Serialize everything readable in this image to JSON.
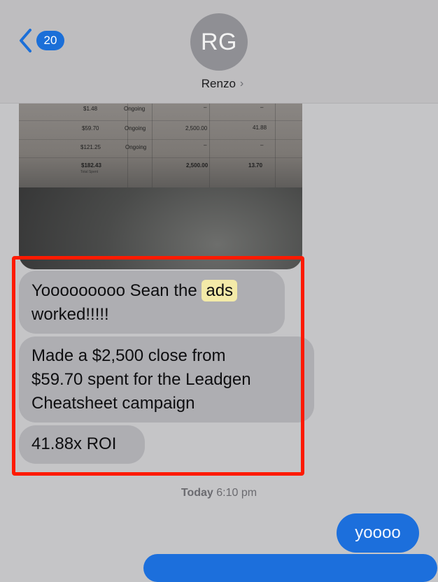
{
  "header": {
    "back_count": "20",
    "avatar_initials": "RG",
    "contact_name": "Renzo",
    "chevron": "›"
  },
  "photo": {
    "rows": [
      {
        "spent": "$1.48",
        "status": "Ongoing",
        "revenue": "–",
        "roi": "–"
      },
      {
        "spent": "$59.70",
        "status": "Ongoing",
        "revenue": "2,500.00",
        "roi": "41.88"
      },
      {
        "spent": "$121.25",
        "status": "Ongoing",
        "revenue": "–",
        "roi": "–"
      }
    ],
    "total": {
      "spent": "$182.43",
      "label": "Total Spent",
      "revenue": "2,500.00",
      "roi": "13.70"
    }
  },
  "messages": {
    "m1_before": "Yooooooooo Sean the ",
    "m1_highlight": "ads",
    "m1_after": "worked!!!!!",
    "m2_line1": "Made a $2,500 close from",
    "m2_line2": "$59.70 spent for the Leadgen",
    "m2_line3": "Cheatsheet campaign",
    "m3": "41.88x ROI"
  },
  "timestamp": {
    "day": "Today",
    "time": "6:10 pm"
  },
  "sent": {
    "m1": "yoooo"
  },
  "colors": {
    "incoming_bubble": "#aeaeb2",
    "outgoing_bubble": "#1c6fdc",
    "annotation": "#ff1a00",
    "highlight": "#f3eaa8"
  }
}
